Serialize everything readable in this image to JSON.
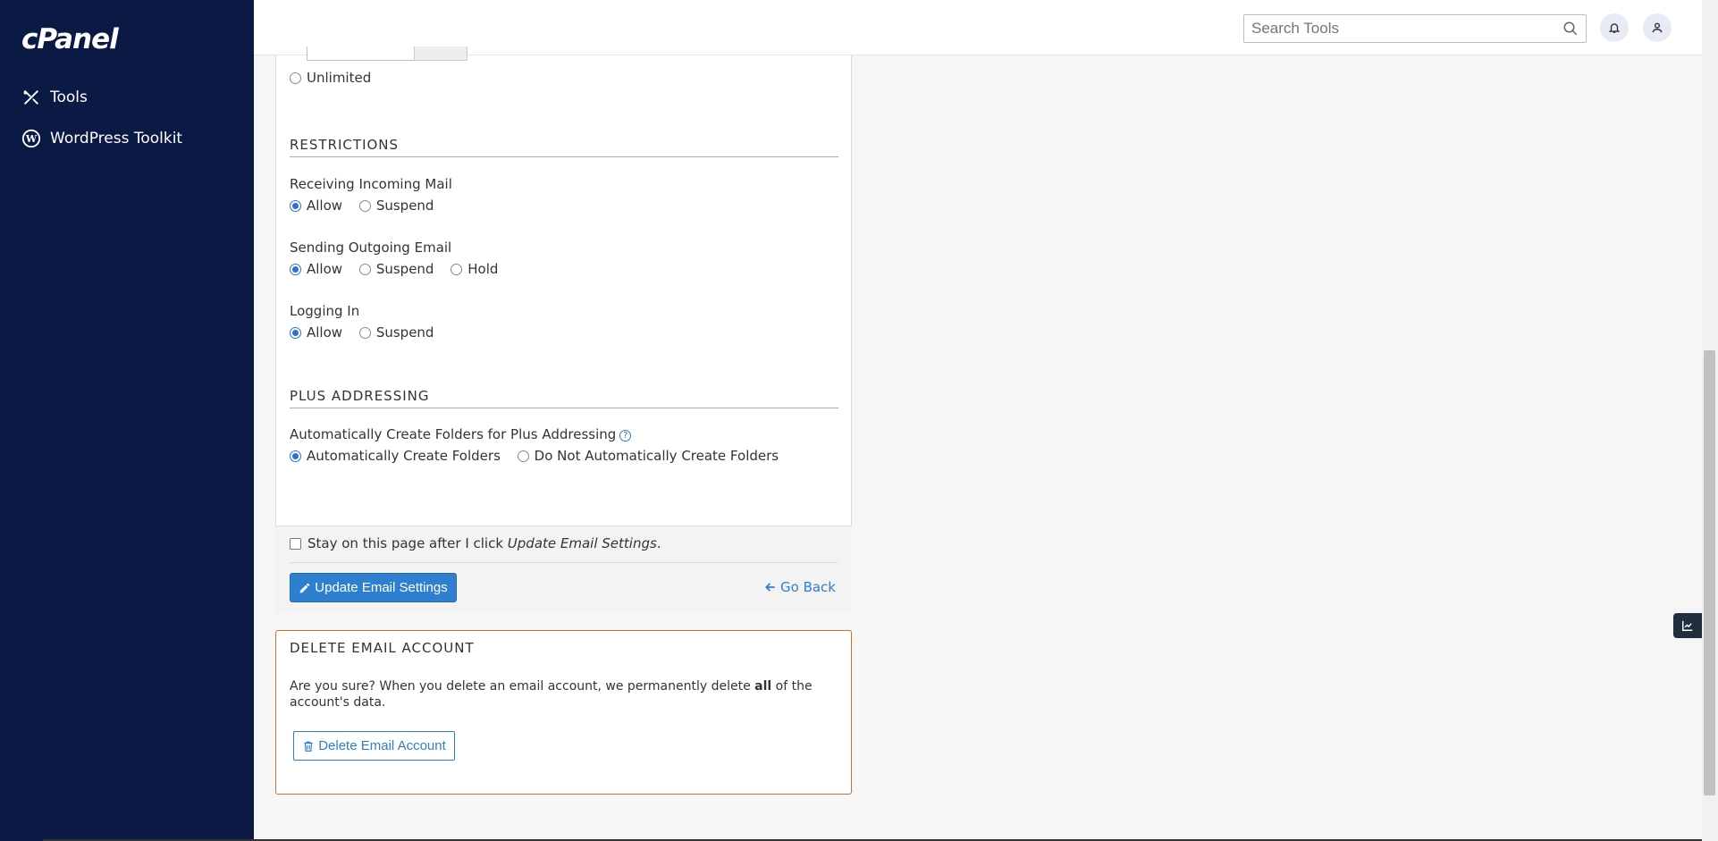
{
  "sidebar": {
    "logo": "cPanel",
    "items": [
      {
        "label": "Tools"
      },
      {
        "label": "WordPress Toolkit"
      }
    ]
  },
  "header": {
    "search_placeholder": "Search Tools"
  },
  "quota": {
    "unlimited_label": "Unlimited"
  },
  "restrictions": {
    "title": "RESTRICTIONS",
    "incoming": {
      "label": "Receiving Incoming Mail",
      "options": [
        "Allow",
        "Suspend"
      ],
      "selected": "Allow"
    },
    "outgoing": {
      "label": "Sending Outgoing Email",
      "options": [
        "Allow",
        "Suspend",
        "Hold"
      ],
      "selected": "Allow"
    },
    "login": {
      "label": "Logging In",
      "options": [
        "Allow",
        "Suspend"
      ],
      "selected": "Allow"
    }
  },
  "plus_addressing": {
    "title": "PLUS ADDRESSING",
    "label": "Automatically Create Folders for Plus Addressing",
    "options": [
      "Automatically Create Folders",
      "Do Not Automatically Create Folders"
    ],
    "selected": "Automatically Create Folders"
  },
  "footer": {
    "stay_text": "Stay on this page after I click ",
    "stay_em": "Update Email Settings",
    "stay_end": ".",
    "update_button": "Update Email Settings",
    "go_back": "Go Back"
  },
  "delete": {
    "title": "DELETE EMAIL ACCOUNT",
    "text_before": "Are you sure? When you delete an email account, we permanently delete ",
    "text_bold": "all",
    "text_after": " of the account's data.",
    "button": "Delete Email Account"
  },
  "colors": {
    "sidebar": "#0b1a45",
    "primary": "#2f7fd0",
    "danger_border": "#e06b25"
  }
}
